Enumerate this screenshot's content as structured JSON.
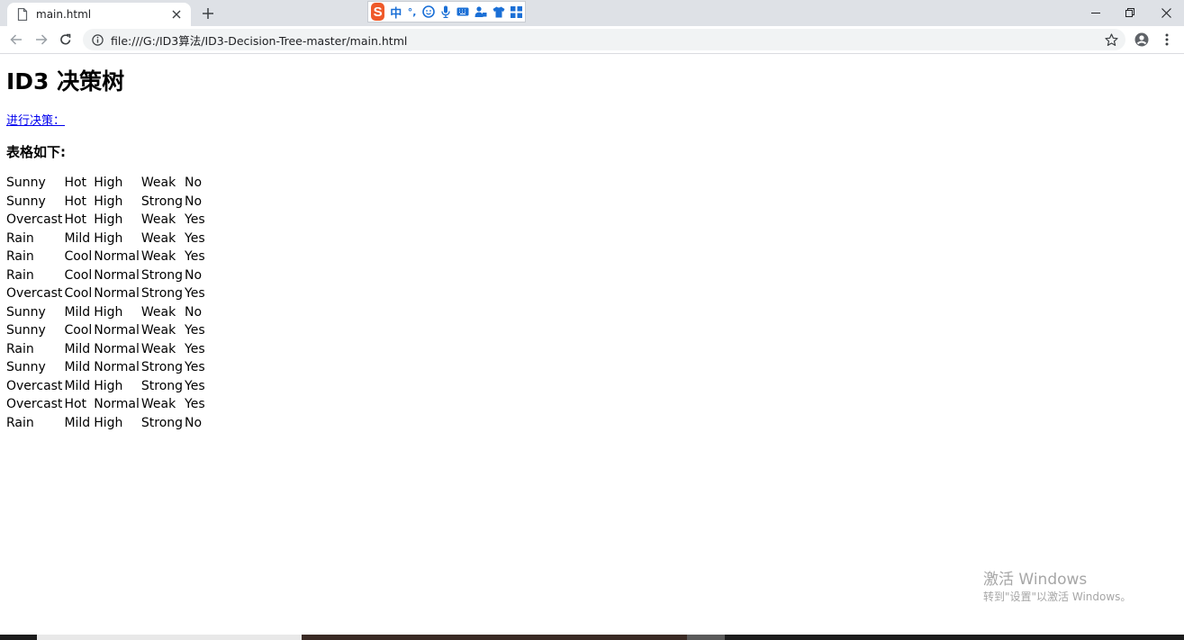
{
  "browser": {
    "tab_title": "main.html",
    "url": "file:///G:/ID3算法/ID3-Decision-Tree-master/main.html"
  },
  "ime": {
    "zh_label": "中",
    "punct_label": "°,"
  },
  "page": {
    "title": "ID3 决策树",
    "link_text": "进行决策：",
    "table_heading": "表格如下:"
  },
  "table_rows": [
    [
      "Sunny",
      "Hot",
      "High",
      "Weak",
      "No"
    ],
    [
      "Sunny",
      "Hot",
      "High",
      "Strong",
      "No"
    ],
    [
      "Overcast",
      "Hot",
      "High",
      "Weak",
      "Yes"
    ],
    [
      "Rain",
      "Mild",
      "High",
      "Weak",
      "Yes"
    ],
    [
      "Rain",
      "Cool",
      "Normal",
      "Weak",
      "Yes"
    ],
    [
      "Rain",
      "Cool",
      "Normal",
      "Strong",
      "No"
    ],
    [
      "Overcast",
      "Cool",
      "Normal",
      "Strong",
      "Yes"
    ],
    [
      "Sunny",
      "Mild",
      "High",
      "Weak",
      "No"
    ],
    [
      "Sunny",
      "Cool",
      "Normal",
      "Weak",
      "Yes"
    ],
    [
      "Rain",
      "Mild",
      "Normal",
      "Weak",
      "Yes"
    ],
    [
      "Sunny",
      "Mild",
      "Normal",
      "Strong",
      "Yes"
    ],
    [
      "Overcast",
      "Mild",
      "High",
      "Strong",
      "Yes"
    ],
    [
      "Overcast",
      "Hot",
      "Normal",
      "Weak",
      "Yes"
    ],
    [
      "Rain",
      "Mild",
      "High",
      "Strong",
      "No"
    ]
  ],
  "watermark": {
    "line1": "激活 Windows",
    "line2": "转到\"设置\"以激活 Windows。"
  },
  "icons": {
    "tab": "file-icon",
    "tab_close": "close-icon",
    "new_tab": "plus-icon",
    "back": "back-arrow-icon",
    "forward": "forward-arrow-icon",
    "reload": "reload-icon",
    "site_info": "info-icon",
    "bookmark": "star-icon",
    "profile": "account-icon",
    "menu": "kebab-menu-icon",
    "minimize": "minimize-icon",
    "restore": "restore-icon",
    "close_window": "close-window-icon"
  },
  "colors": {
    "link": "#0000ee",
    "tabstrip": "#dee1e6",
    "ime_logo": "#ef5a2a",
    "ime_blue": "#1a6fd6",
    "watermark": "#a6a6a6"
  }
}
